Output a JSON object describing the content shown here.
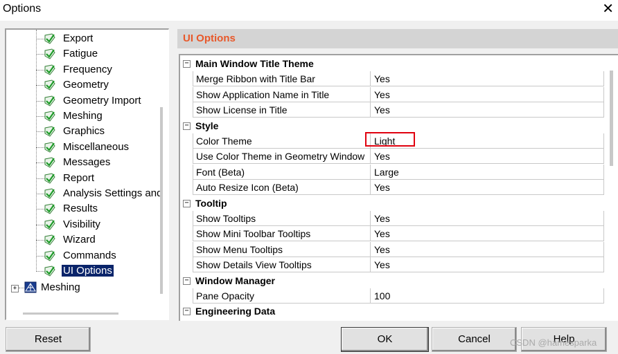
{
  "window": {
    "title": "Options",
    "close_glyph": "✕"
  },
  "tree": {
    "items": [
      {
        "label": "Export"
      },
      {
        "label": "Fatigue"
      },
      {
        "label": "Frequency"
      },
      {
        "label": "Geometry"
      },
      {
        "label": "Geometry Import"
      },
      {
        "label": "Meshing"
      },
      {
        "label": "Graphics"
      },
      {
        "label": "Miscellaneous"
      },
      {
        "label": "Messages"
      },
      {
        "label": "Report"
      },
      {
        "label": "Analysis Settings and"
      },
      {
        "label": "Results"
      },
      {
        "label": "Visibility"
      },
      {
        "label": "Wizard"
      },
      {
        "label": "Commands"
      },
      {
        "label": "UI Options",
        "selected": true
      }
    ],
    "root": {
      "label": "Meshing",
      "expander": "+"
    },
    "check_icon": "green-check-icon",
    "root_icon": "meshing-icon"
  },
  "panel": {
    "title": "UI Options",
    "title_color": "#e8582a"
  },
  "grid": {
    "sections": [
      {
        "title": "Main Window Title Theme",
        "expander": "−",
        "rows": [
          {
            "name": "Merge Ribbon with Title Bar",
            "value": "Yes"
          },
          {
            "name": "Show Application Name in Title",
            "value": "Yes"
          },
          {
            "name": "Show License in Title",
            "value": "Yes"
          }
        ]
      },
      {
        "title": "Style",
        "expander": "−",
        "rows": [
          {
            "name": "Color Theme",
            "value": "Light"
          },
          {
            "name": "Use Color Theme in Geometry Window",
            "value": "Yes"
          },
          {
            "name": "Font (Beta)",
            "value": "Large"
          },
          {
            "name": "Auto Resize Icon (Beta)",
            "value": "Yes"
          }
        ]
      },
      {
        "title": "Tooltip",
        "expander": "−",
        "rows": [
          {
            "name": "Show Tooltips",
            "value": "Yes"
          },
          {
            "name": "Show Mini Toolbar Tooltips",
            "value": "Yes"
          },
          {
            "name": "Show Menu Tooltips",
            "value": "Yes"
          },
          {
            "name": "Show Details View Tooltips",
            "value": "Yes"
          }
        ]
      },
      {
        "title": "Window Manager",
        "expander": "−",
        "rows": [
          {
            "name": "Pane Opacity",
            "value": "100"
          }
        ]
      },
      {
        "title": "Engineering Data",
        "expander": "−",
        "rows": []
      }
    ],
    "highlight_color": "#e0000e"
  },
  "buttons": {
    "reset": "Reset",
    "ok": "OK",
    "cancel": "Cancel",
    "help": "Help"
  },
  "watermark": "CSDN @hamesparka"
}
